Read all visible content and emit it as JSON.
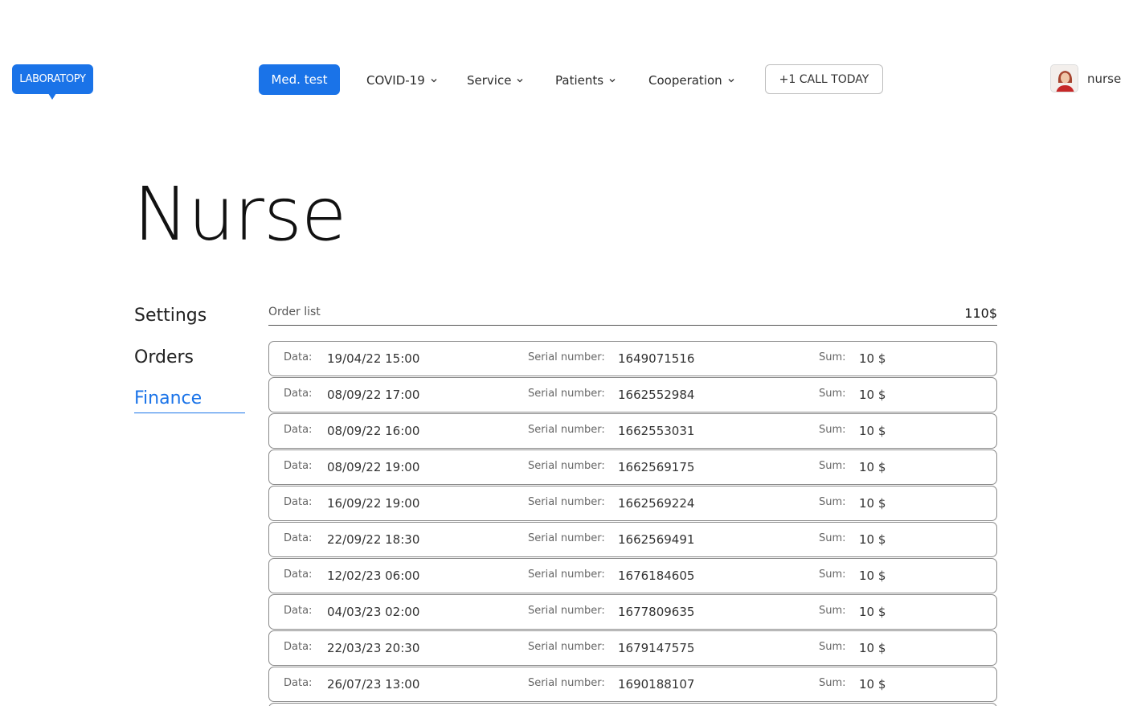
{
  "brand": {
    "logo_text": "LABORATOPY"
  },
  "nav": {
    "primary_label": "Med. test",
    "items": [
      {
        "label": "COVID-19"
      },
      {
        "label": "Service"
      },
      {
        "label": "Patients"
      },
      {
        "label": "Cooperation"
      }
    ],
    "call_label": "+1 CALL TODAY"
  },
  "user": {
    "name": "nurse",
    "avatar_icon": "user-avatar-photo"
  },
  "page": {
    "title": "Nurse"
  },
  "side_menu": {
    "items": [
      {
        "label": "Settings"
      },
      {
        "label": "Orders"
      },
      {
        "label": "Finance"
      }
    ],
    "active": "Finance"
  },
  "orders": {
    "list_label": "Order list",
    "total": "110$",
    "date_label": "Data:",
    "serial_label": "Serial number:",
    "sum_label": "Sum:",
    "rows": [
      {
        "date": "19/04/22 15:00",
        "serial": "1649071516",
        "sum": "10 $"
      },
      {
        "date": "08/09/22 17:00",
        "serial": "1662552984",
        "sum": "10 $"
      },
      {
        "date": "08/09/22 16:00",
        "serial": "1662553031",
        "sum": "10 $"
      },
      {
        "date": "08/09/22 19:00",
        "serial": "1662569175",
        "sum": "10 $"
      },
      {
        "date": "16/09/22 19:00",
        "serial": "1662569224",
        "sum": "10 $"
      },
      {
        "date": "22/09/22 18:30",
        "serial": "1662569491",
        "sum": "10 $"
      },
      {
        "date": "12/02/23 06:00",
        "serial": "1676184605",
        "sum": "10 $"
      },
      {
        "date": "04/03/23 02:00",
        "serial": "1677809635",
        "sum": "10 $"
      },
      {
        "date": "22/03/23 20:30",
        "serial": "1679147575",
        "sum": "10 $"
      },
      {
        "date": "26/07/23 13:00",
        "serial": "1690188107",
        "sum": "10 $"
      }
    ]
  },
  "colors": {
    "accent": "#1a73e8",
    "text": "#1c1c1c",
    "row_border": "#8a8a8a"
  }
}
